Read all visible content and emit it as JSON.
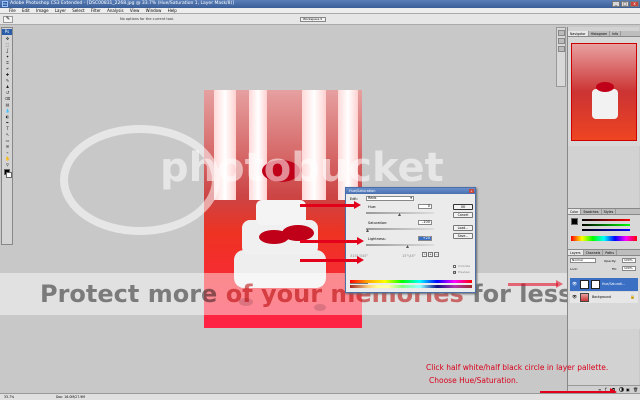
{
  "window": {
    "title": "Adobe Photoshop CS3 Extended - [DSC00831_2268.jpg @ 33.7% (Hue/Saturation 1, Layer Mask/8)]",
    "app_icon": "Ps",
    "min": "_",
    "max": "□",
    "close": "x"
  },
  "menubar": [
    "File",
    "Edit",
    "Image",
    "Layer",
    "Select",
    "Filter",
    "Analysis",
    "View",
    "Window",
    "Help"
  ],
  "optbar": {
    "message": "No options for the current tool.",
    "workspace": "Workspace ▾"
  },
  "toolbox": {
    "header": "Ps",
    "tools": [
      "move-tool",
      "marquee-tool",
      "lasso-tool",
      "magic-wand-tool",
      "crop-tool",
      "slice-tool",
      "healing-tool",
      "brush-tool",
      "stamp-tool",
      "history-brush-tool",
      "eraser-tool",
      "gradient-tool",
      "blur-tool",
      "dodge-tool",
      "pen-tool",
      "type-tool",
      "path-select-tool",
      "shape-tool",
      "notes-tool",
      "eyedropper-tool",
      "hand-tool",
      "zoom-tool"
    ],
    "tool_glyphs": [
      "✥",
      "⬚",
      "ʆ",
      "✦",
      "⌗",
      "⌿",
      "✚",
      "✎",
      "♟",
      "↺",
      "⌫",
      "▤",
      "💧",
      "◐",
      "✒",
      "T",
      "↖",
      "▭",
      "✉",
      "⌁",
      "✋",
      "⚲"
    ],
    "fg_color": "#000000",
    "bg_color": "#ffffff"
  },
  "dialog": {
    "title": "Hue/Saturation",
    "edit_label": "Edit:",
    "edit_value": "Reds",
    "hue_label": "Hue:",
    "hue_value": "0",
    "saturation_label": "Saturation:",
    "saturation_value": "-100",
    "lightness_label": "Lightness:",
    "lightness_value": "+20",
    "range_left": "315°/345°",
    "range_right": "15°\\45°",
    "ok": "OK",
    "cancel": "Cancel",
    "load": "Load...",
    "save": "Save...",
    "colorize": "Colorize",
    "preview": "Preview"
  },
  "panels": {
    "navigator_tabs": [
      "Navigator",
      "Histogram",
      "Info"
    ],
    "color_tabs": [
      "Color",
      "Swatches",
      "Styles"
    ],
    "layers_tabs": [
      "Layers",
      "Channels",
      "Paths"
    ],
    "blend_mode": "Normal",
    "opacity_label": "Opacity:",
    "opacity_value": "100%",
    "lock_label": "Lock:",
    "fill_label": "Fill:",
    "fill_value": "100%",
    "layer_hue": "Hue/Saturati...",
    "layer_bg": "Background"
  },
  "status": {
    "zoom": "33.7%",
    "doc": "Doc: 16.0M/27.9M"
  },
  "annotation": {
    "line1": "Click half white/half black circle in layer pallette.",
    "line2": "Choose Hue/Saturation."
  },
  "watermark": {
    "brand": "photobucket",
    "protect": "Protect more ",
    "protect_red": "of your memories",
    "protect_tail": " for less!"
  },
  "colors": {
    "accent_red": "#e3001a",
    "title_blue": "#3a5f98",
    "selected_layer": "#3a6fc4"
  }
}
